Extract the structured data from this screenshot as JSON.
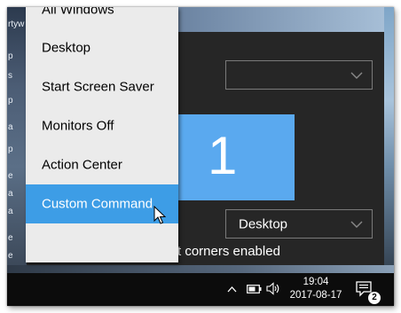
{
  "desktop": {
    "left_fragments": [
      "rtyw",
      "p",
      "s",
      "p",
      "a",
      "p",
      "e",
      "a",
      "a",
      "e",
      "e"
    ]
  },
  "settings": {
    "top_dropdown_value": "",
    "monitor_number": "1",
    "action_dropdown_value": "Desktop",
    "corners_text": "t corners enabled"
  },
  "context_menu": {
    "items": [
      {
        "label": "All Windows",
        "selected": false
      },
      {
        "label": "Desktop",
        "selected": false
      },
      {
        "label": "Start Screen Saver",
        "selected": false
      },
      {
        "label": "Monitors Off",
        "selected": false
      },
      {
        "label": "Action Center",
        "selected": false
      },
      {
        "label": "Custom Command",
        "selected": true
      }
    ]
  },
  "taskbar": {
    "time": "19:04",
    "date": "2017-08-17",
    "notification_count": "2",
    "icons": [
      "chevron-up-icon",
      "battery-icon",
      "volume-icon",
      "action-center-icon"
    ]
  },
  "colors": {
    "accent": "#3d9de6",
    "monitor_tile": "#5aa9ef",
    "settings_bg": "#262626",
    "menu_bg": "#ebebeb",
    "taskbar_bg": "#0c0c0c"
  }
}
